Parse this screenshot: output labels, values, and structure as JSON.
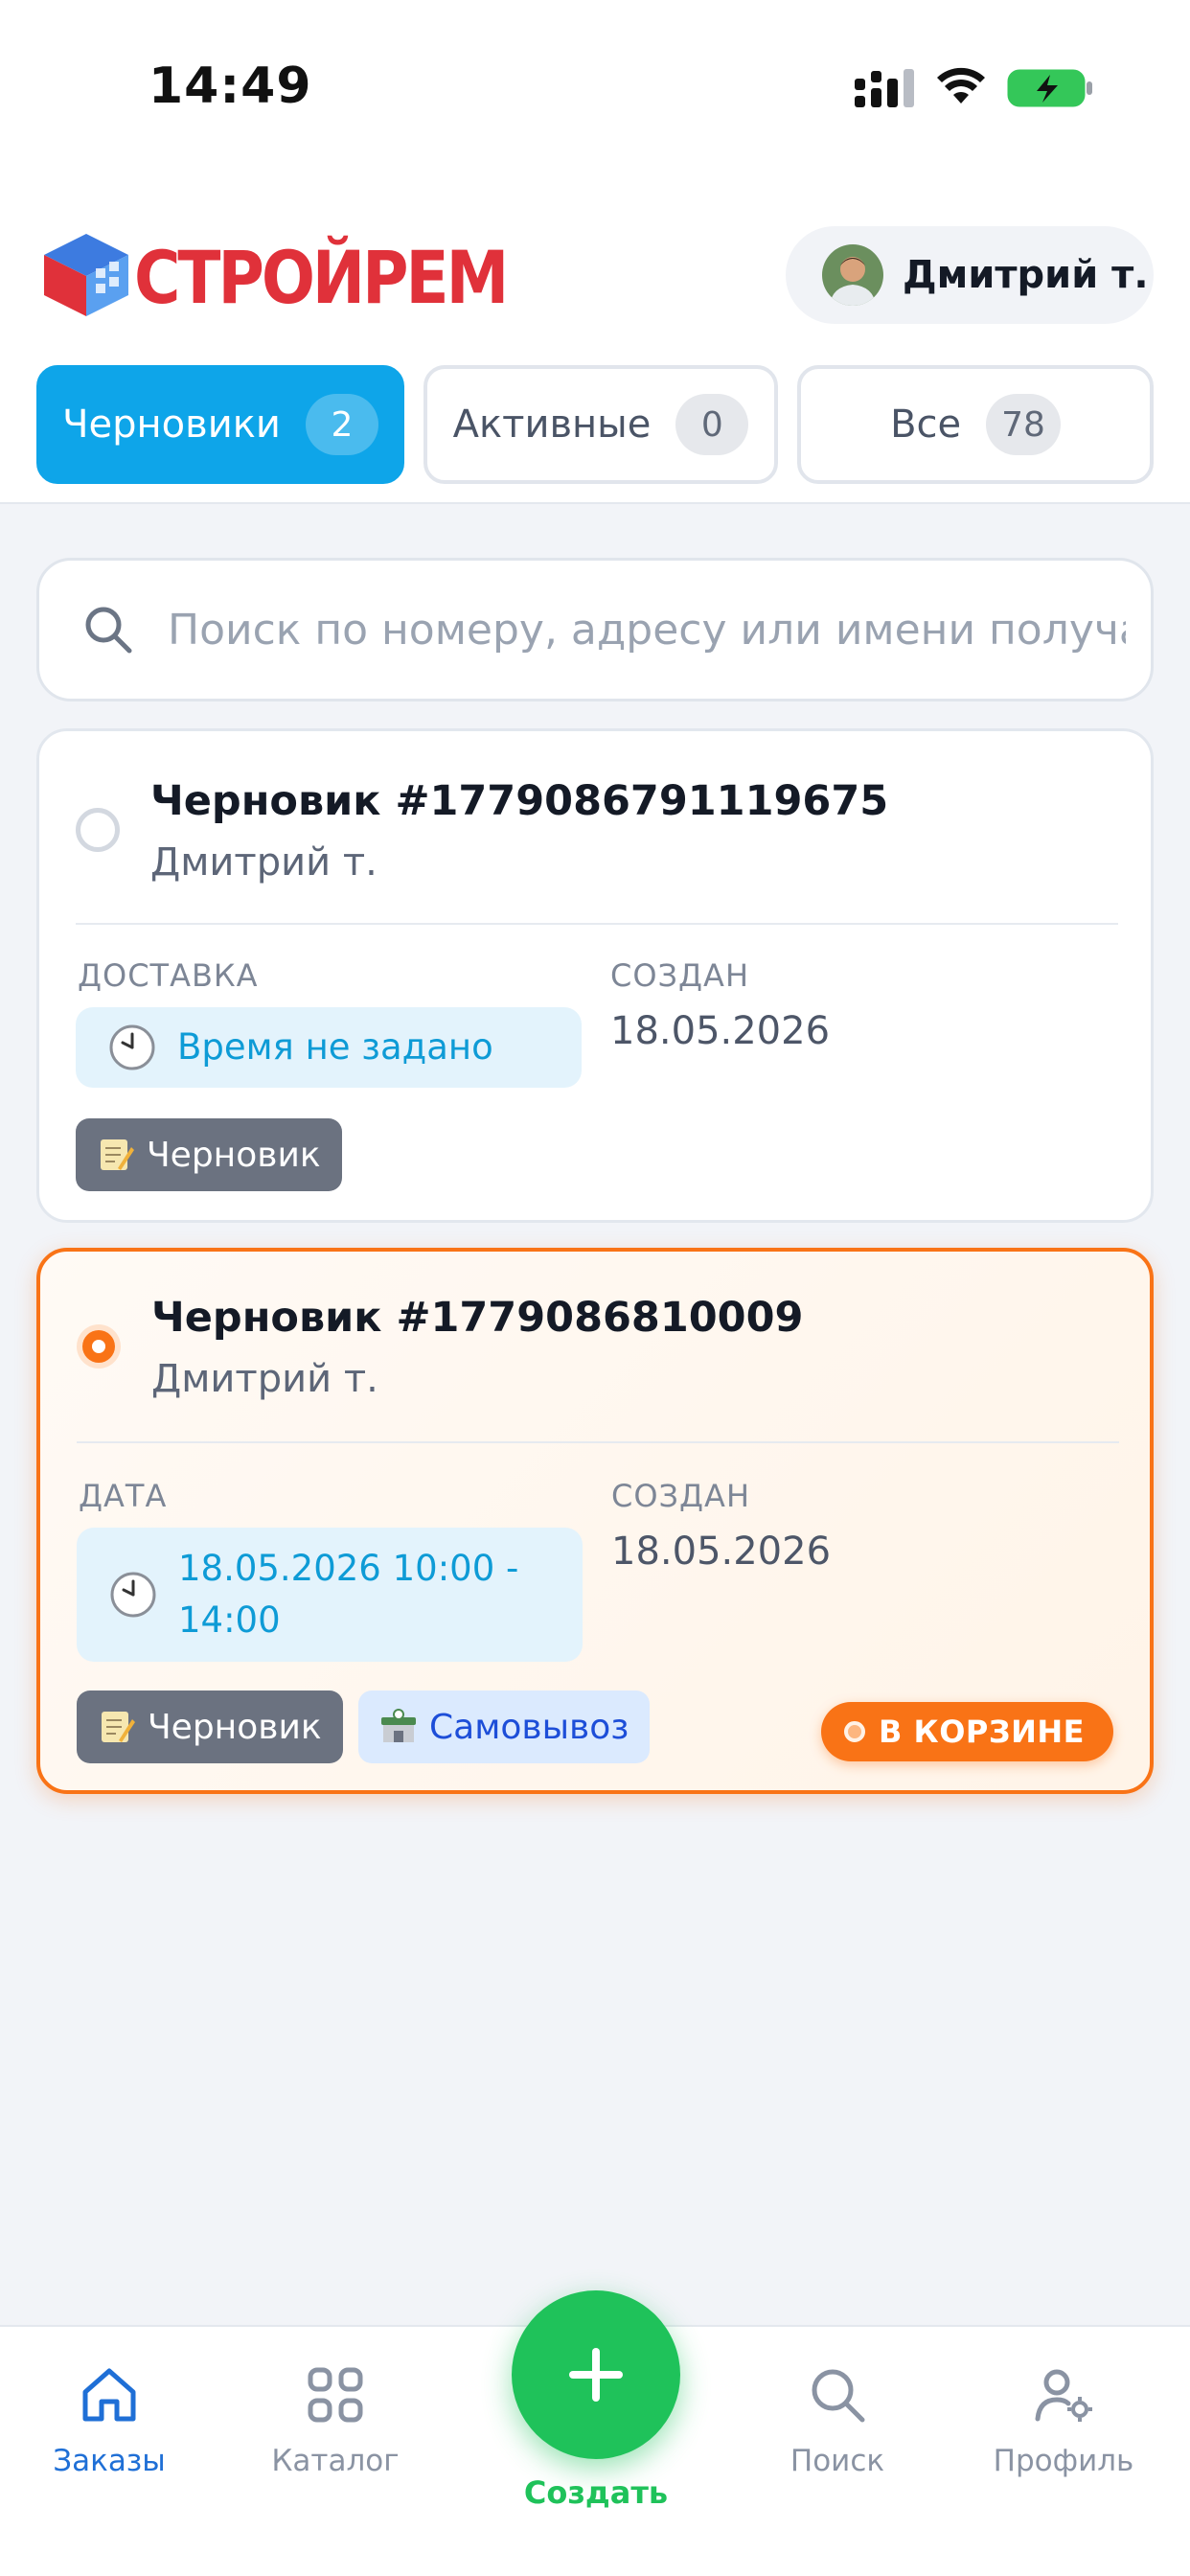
{
  "status_bar": {
    "time": "14:49"
  },
  "header": {
    "brand": "СТРОЙРЕМ",
    "user_name": "Дмитрий т."
  },
  "tabs": [
    {
      "label": "Черновики",
      "count": "2",
      "active": true
    },
    {
      "label": "Активные",
      "count": "0",
      "active": false
    },
    {
      "label": "Все",
      "count": "78",
      "active": false
    }
  ],
  "search": {
    "placeholder": "Поиск по номеру, адресу или имени получателя"
  },
  "orders": [
    {
      "title": "Черновик #1779086791119675",
      "customer": "Дмитрий т.",
      "time_label": "ДОСТАВКА",
      "time_value": "Время не задано",
      "created_label": "СОЗДАН",
      "created_value": "18.05.2026",
      "status_chip": "Черновик",
      "selected": false
    },
    {
      "title": "Черновик #1779086810009",
      "customer": "Дмитрий т.",
      "time_label": "ДАТА",
      "time_value": "18.05.2026 10:00 - 14:00",
      "created_label": "СОЗДАН",
      "created_value": "18.05.2026",
      "status_chip": "Черновик",
      "delivery_chip": "Самовывоз",
      "cart_badge": "В КОРЗИНЕ",
      "selected": true
    }
  ],
  "bottom_nav": {
    "items": [
      {
        "label": "Заказы",
        "icon": "home-icon",
        "active": true
      },
      {
        "label": "Каталог",
        "icon": "grid-icon",
        "active": false
      },
      {
        "label": "Поиск",
        "icon": "search-icon",
        "active": false
      },
      {
        "label": "Профиль",
        "icon": "profile-settings-icon",
        "active": false
      }
    ],
    "create_label": "Создать"
  },
  "colors": {
    "accent_blue": "#0ea5e9",
    "selected_orange": "#f97316",
    "create_green": "#1fc25a",
    "nav_active": "#1f6fd6"
  }
}
